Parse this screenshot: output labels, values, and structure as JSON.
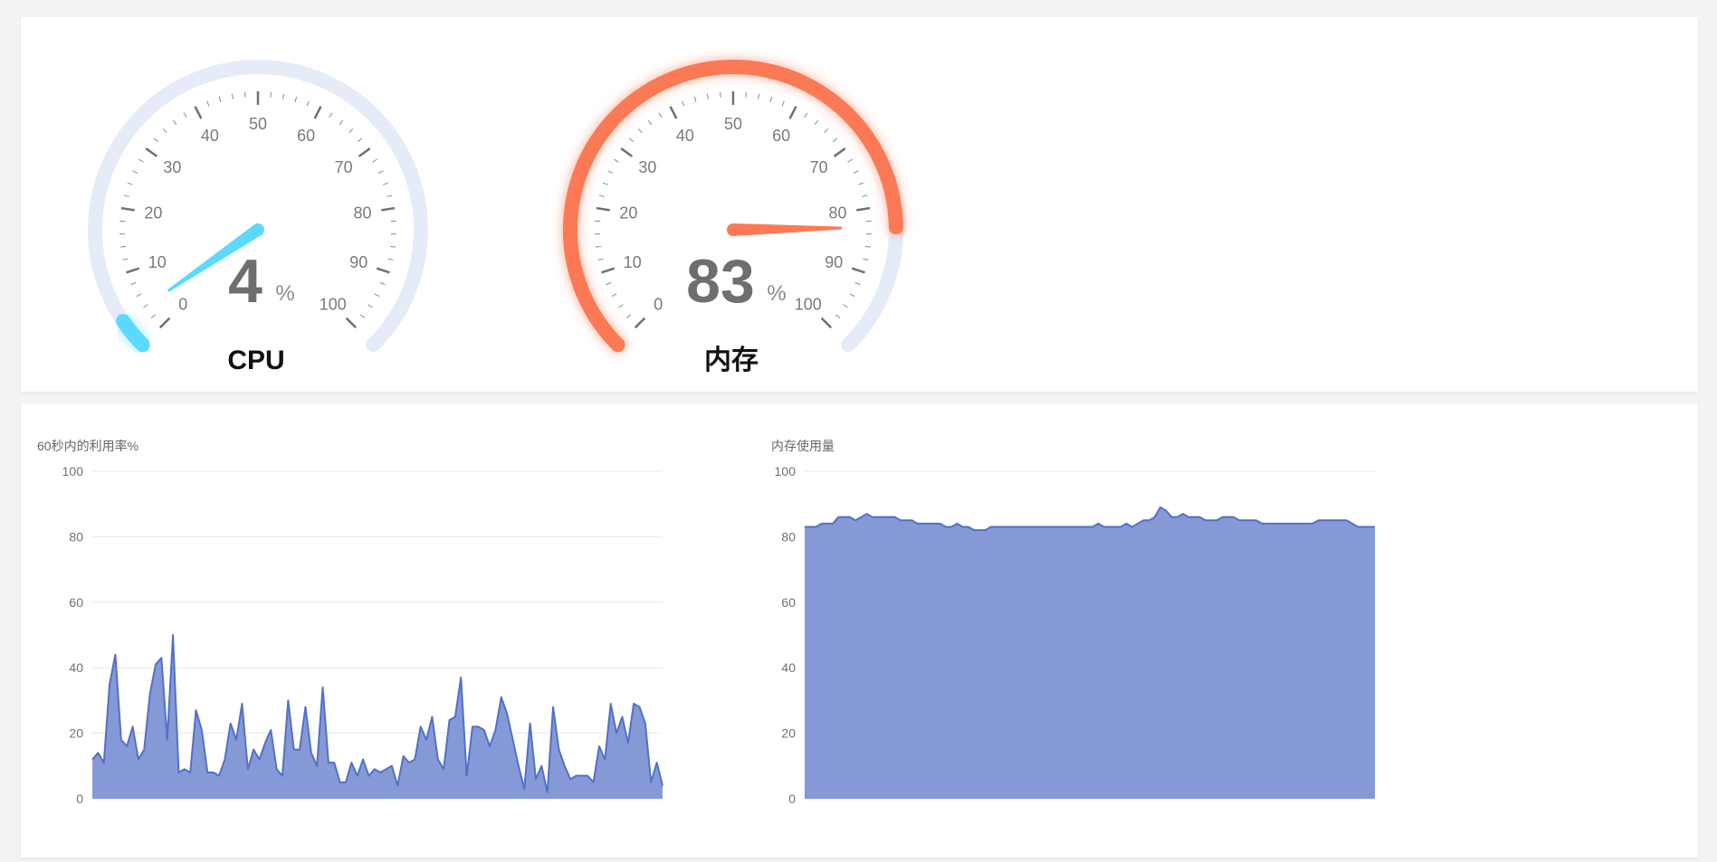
{
  "gauges": [
    {
      "name": "CPU",
      "value": 4,
      "unit": "%",
      "min": 0,
      "max": 100,
      "color": "#5cd9fe",
      "track_color": "#e6ebf8",
      "tick_labels": [
        "0",
        "10",
        "20",
        "30",
        "40",
        "50",
        "60",
        "70",
        "80",
        "90",
        "100"
      ]
    },
    {
      "name": "内存",
      "value": 83,
      "unit": "%",
      "min": 0,
      "max": 100,
      "color": "#fb7a55",
      "track_color": "#e6ebf8",
      "tick_labels": [
        "0",
        "10",
        "20",
        "30",
        "40",
        "50",
        "60",
        "70",
        "80",
        "90",
        "100"
      ]
    }
  ],
  "chart_data": [
    {
      "type": "area",
      "title": "60秒内的利用率%",
      "ylim": [
        0,
        100
      ],
      "y_ticks": [
        "0",
        "20",
        "40",
        "60",
        "80",
        "100"
      ],
      "grid": true,
      "line_color": "#5470c6",
      "fill_color": "#8599d6",
      "values": [
        12,
        14,
        11,
        35,
        44,
        18,
        16,
        22,
        12,
        15,
        32,
        41,
        43,
        18,
        50,
        8,
        9,
        8,
        27,
        21,
        8,
        8,
        7,
        12,
        23,
        18,
        29,
        9,
        15,
        12,
        17,
        21,
        9,
        7,
        30,
        15,
        15,
        28,
        14,
        10,
        34,
        11,
        11,
        5,
        5,
        11,
        7,
        12,
        7,
        9,
        8,
        9,
        10,
        4,
        13,
        11,
        12,
        22,
        18,
        25,
        12,
        9,
        24,
        25,
        37,
        7,
        22,
        22,
        21,
        16,
        21,
        31,
        26,
        18,
        10,
        3,
        23,
        6,
        10,
        2,
        28,
        15,
        10,
        6,
        7,
        7,
        7,
        5,
        16,
        12,
        29,
        20,
        25,
        17,
        29,
        28,
        23,
        5,
        11,
        4
      ]
    },
    {
      "type": "area",
      "title": "内存使用量",
      "ylim": [
        0,
        100
      ],
      "y_ticks": [
        "0",
        "20",
        "40",
        "60",
        "80",
        "100"
      ],
      "grid": true,
      "line_color": "#5470c6",
      "fill_color": "#8599d6",
      "values": [
        83,
        83,
        83,
        84,
        84,
        84,
        86,
        86,
        86,
        85,
        86,
        87,
        86,
        86,
        86,
        86,
        86,
        85,
        85,
        85,
        84,
        84,
        84,
        84,
        84,
        83,
        83,
        84,
        83,
        83,
        82,
        82,
        82,
        83,
        83,
        83,
        83,
        83,
        83,
        83,
        83,
        83,
        83,
        83,
        83,
        83,
        83,
        83,
        83,
        83,
        83,
        83,
        84,
        83,
        83,
        83,
        83,
        84,
        83,
        84,
        85,
        85,
        86,
        89,
        88,
        86,
        86,
        87,
        86,
        86,
        86,
        85,
        85,
        85,
        86,
        86,
        86,
        85,
        85,
        85,
        85,
        84,
        84,
        84,
        84,
        84,
        84,
        84,
        84,
        84,
        84,
        85,
        85,
        85,
        85,
        85,
        85,
        84,
        83,
        83,
        83,
        83
      ]
    }
  ]
}
